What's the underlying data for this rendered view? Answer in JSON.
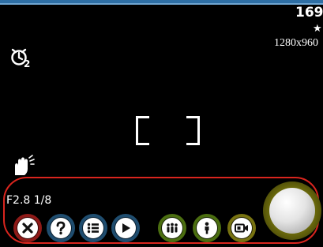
{
  "status": {
    "shot_count": "169",
    "resolution": "1280x960"
  },
  "exposure": {
    "text": "F2.8 1/8"
  },
  "icons": {
    "timer": "self-timer-2s-icon",
    "stabilizer": "hand-shake-icon",
    "rating": "star-icon"
  },
  "controls": [
    {
      "name": "close-button",
      "icon": "close-icon",
      "ring_color": "#8e1a18"
    },
    {
      "name": "help-button",
      "icon": "question-icon",
      "ring_color": "#1f4d6f"
    },
    {
      "name": "menu-list-button",
      "icon": "list-icon",
      "ring_color": "#1f4d6f"
    },
    {
      "name": "playback-button",
      "icon": "play-icon",
      "ring_color": "#1f4d6f"
    },
    {
      "name": "group-mode-button",
      "icon": "group-icon",
      "ring_color": "#4b6e10"
    },
    {
      "name": "portrait-mode-button",
      "icon": "person-icon",
      "ring_color": "#4b6e10"
    },
    {
      "name": "video-mode-button",
      "icon": "video-camera-icon",
      "ring_color": "#777210"
    }
  ],
  "colors": {
    "frame_accent": "#2e6fa5",
    "controls_outline": "#d9251e",
    "shutter_ring": "#6b6a0c"
  }
}
